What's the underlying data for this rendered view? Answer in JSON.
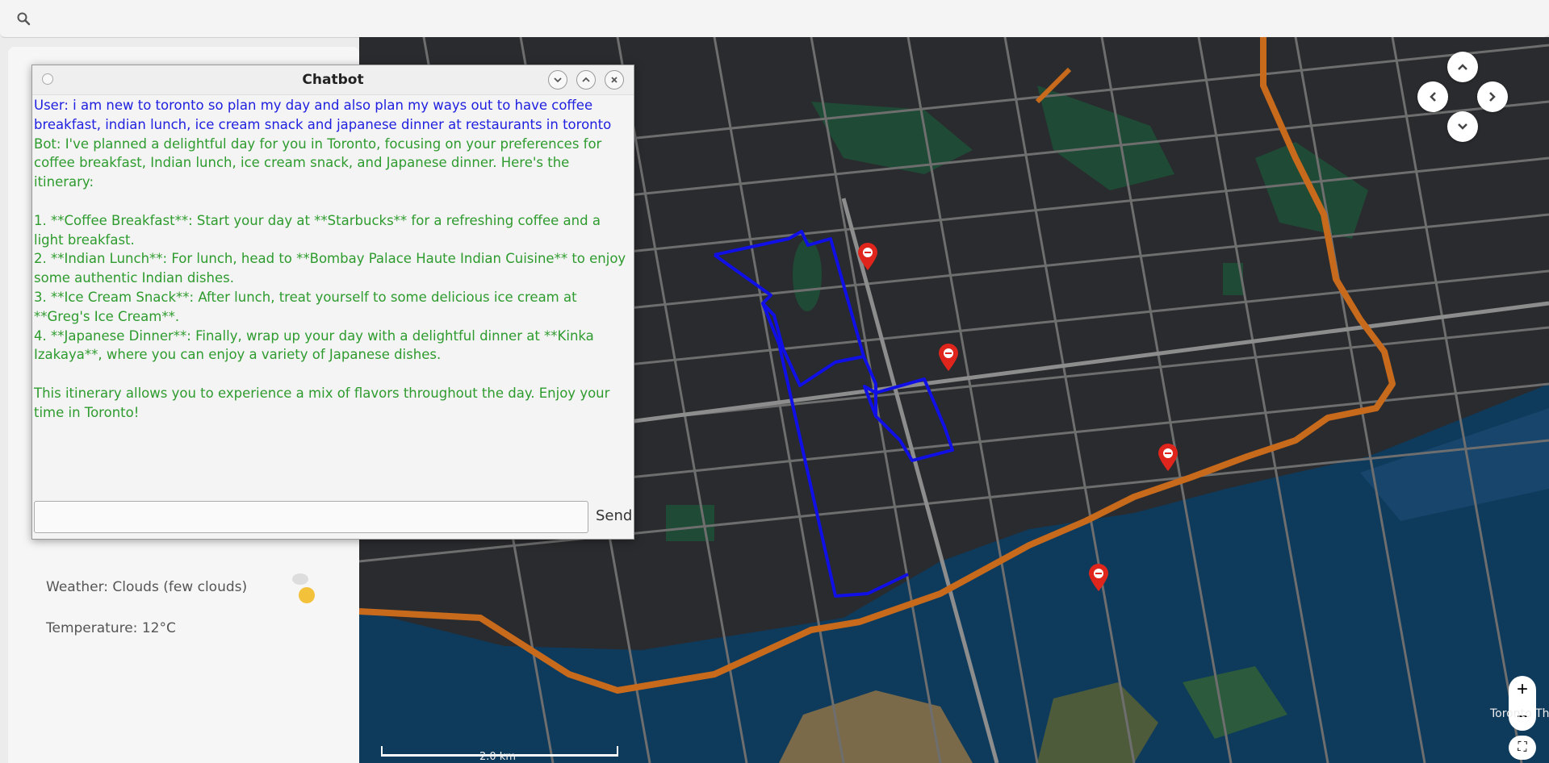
{
  "search": {
    "value": "",
    "placeholder": ""
  },
  "sidebar": {
    "weather": "Weather: Clouds (few clouds)",
    "temperature": "Temperature: 12°C"
  },
  "chat": {
    "title": "Chatbot",
    "user_message": "User: i am new to toronto so plan my day and also plan my ways out to have coffee breakfast, indian lunch, ice cream snack and japanese dinner at restaurants in toronto",
    "bot_message": "Bot: I've planned a delightful day for you in Toronto, focusing on your preferences for coffee breakfast, Indian lunch, ice cream snack, and Japanese dinner. Here's the itinerary:\n\n1. **Coffee Breakfast**: Start your day at **Starbucks** for a refreshing coffee and a light breakfast.\n2. **Indian Lunch**: For lunch, head to **Bombay Palace Haute Indian Cuisine** to enjoy some authentic Indian dishes.\n3. **Ice Cream Snack**: After lunch, treat yourself to some delicious ice cream at **Greg's Ice Cream**.\n4. **Japanese Dinner**: Finally, wrap up your day with a delightful dinner at **Kinka Izakaya**, where you can enjoy a variety of Japanese dishes.\n\nThis itinerary allows you to experience a mix of flavors throughout the day. Enjoy your time in Toronto!",
    "input_value": "",
    "send_label": "Send"
  },
  "map": {
    "scale_label": "2.0 km",
    "attribution": "Toronto Th",
    "colors": {
      "land": "#2a2b2e",
      "water": "#0e3a5c",
      "park": "#1f4a36",
      "road": "#7a7a7a",
      "highway": "#c76a1c",
      "route": "#1010e6",
      "marker": "#e0261c"
    }
  }
}
